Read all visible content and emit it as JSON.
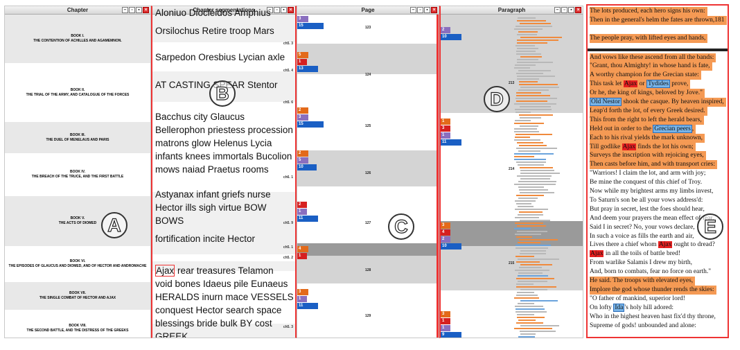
{
  "panels": {
    "chapter": {
      "title": "Chapter"
    },
    "segments": {
      "title": "Chapter segmentations"
    },
    "page": {
      "title": "Page"
    },
    "paragraph": {
      "title": "Paragraph"
    }
  },
  "chapters": [
    {
      "num": "BOOK I.",
      "title": "THE CONTENTION OF ACHILLES AND AGAMEMNON."
    },
    {
      "num": "BOOK II.",
      "title": "THE TRIAL OF THE ARMY, AND CATALOGUE OF THE FORCES"
    },
    {
      "num": "BOOK III.",
      "title": "THE DUEL OF MENELAUS AND PARIS"
    },
    {
      "num": "BOOK IV.",
      "title": "THE BREACH OF THE TRUCE, AND THE FIRST BATTLE"
    },
    {
      "num": "BOOK V.",
      "title": "THE ACTS OF DIOMED"
    },
    {
      "num": "BOOK VI.",
      "title": "THE EPISODES OF GLAUCUS AND DIOMED, AND OF HECTOR AND ANDROMACHE"
    },
    {
      "num": "BOOK VII.",
      "title": "THE SINGLE COMBAT OF HECTOR AND AJAX"
    },
    {
      "num": "BOOK VIII.",
      "title": "THE SECOND BATTLE, AND THE DISTRESS OF THE GREEKS"
    }
  ],
  "segments": [
    {
      "words": "Aloniuo Diocleidos Amphius",
      "label": ""
    },
    {
      "words": "Orsilochus Retire troop Mars",
      "label": "ch5. 3"
    },
    {
      "words": "Sarpedon Oresbius Lycian axle",
      "label": "ch5. 4"
    },
    {
      "words": "AT CASTING SPEAR Stentor",
      "label": "ch5. 6"
    },
    {
      "words": "Bacchus city Glaucus\nBellerophon priestess procession\nmatrons glow Helenus Lycia\ninfants knees immortals Bucolion\nmows naiad Praetus rooms",
      "label": "ch6. 1"
    },
    {
      "words": "Astyanax infant griefs nurse\nHector ills sigh virtue BOW BOWS",
      "label": "ch5. 9"
    },
    {
      "words": "fortification incite Hector",
      "label": "ch5. 1"
    },
    {
      "words": "",
      "label": "ch5. 2"
    },
    {
      "words": "Ajax rear treasures Telamon\nvoid bones Idaeus pile Eunaeus\nHERALDS inurn mace VESSELS\nconquest Hector search space\nblessings bride bulk BY cost GREEK",
      "label": "ch5. 3"
    }
  ],
  "page_marks": [
    {
      "v": "3",
      "c": "#8a6fbf"
    },
    {
      "v": "15",
      "c": "#1a5fc4"
    },
    {
      "v": "5",
      "c": "#e36a1a"
    },
    {
      "v": "1",
      "c": "#d62020"
    },
    {
      "v": "13",
      "c": "#1a5fc4"
    },
    {
      "v": "2",
      "c": "#e36a1a"
    },
    {
      "v": "3",
      "c": "#8a6fbf"
    },
    {
      "v": "15",
      "c": "#1a5fc4"
    },
    {
      "v": "2",
      "c": "#e36a1a"
    },
    {
      "v": "5",
      "c": "#8a6fbf"
    },
    {
      "v": "10",
      "c": "#1a5fc4"
    },
    {
      "v": "2",
      "c": "#d62020"
    },
    {
      "v": "1",
      "c": "#8a6fbf"
    },
    {
      "v": "11",
      "c": "#1a5fc4"
    },
    {
      "v": "4",
      "c": "#e36a1a"
    },
    {
      "v": "1",
      "c": "#d62020"
    },
    {
      "v": "3",
      "c": "#e36a1a"
    },
    {
      "v": "1",
      "c": "#8a6fbf"
    },
    {
      "v": "11",
      "c": "#1a5fc4"
    }
  ],
  "page_numbers": [
    "123",
    "124",
    "125",
    "126",
    "127",
    "128",
    "129"
  ],
  "para_marks": [
    {
      "v": "2",
      "c": "#8a6fbf"
    },
    {
      "v": "10",
      "c": "#1a5fc4"
    },
    {
      "v": "1",
      "c": "#e36a1a"
    },
    {
      "v": "3",
      "c": "#d62020"
    },
    {
      "v": "1",
      "c": "#8a6fbf"
    },
    {
      "v": "11",
      "c": "#1a5fc4"
    },
    {
      "v": "3",
      "c": "#e36a1a"
    },
    {
      "v": "4",
      "c": "#d62020"
    },
    {
      "v": "2",
      "c": "#8a6fbf"
    },
    {
      "v": "10",
      "c": "#1a5fc4"
    },
    {
      "v": "3",
      "c": "#e36a1a"
    },
    {
      "v": "1",
      "c": "#d62020"
    },
    {
      "v": "1",
      "c": "#8a6fbf"
    },
    {
      "v": "9",
      "c": "#1a5fc4"
    }
  ],
  "para_numbers": [
    "213",
    "214",
    "215"
  ],
  "text_lines": [
    {
      "t": "The lots produced, each hero signs his own:",
      "o": true
    },
    {
      "t": "Then in the general's helm the fates are thrown,181",
      "o": true
    },
    {
      "t": "",
      "o": true
    },
    {
      "t": "The people pray, with lifted eyes and hands,",
      "o": true
    },
    {
      "t": "",
      "o": false
    },
    {
      "t": "And vows like these ascend from all the bands:",
      "o": true
    },
    {
      "t": "\"Grant, thou Almighty! in whose hand is fate,",
      "o": true
    },
    {
      "t": "A worthy champion for the Grecian state:",
      "o": true
    },
    {
      "t": "This task let |Ajax| or |Tydides| prove,",
      "o": true
    },
    {
      "t": "Or he, the king of kings, beloved by Jove.\"",
      "o": true
    },
    {
      "t": "|Old Nestor| shook the casque. By heaven inspired,",
      "o": true
    },
    {
      "t": "Leap'd forth the lot, of every Greek desired.",
      "o": true
    },
    {
      "t": "This from the right to left the herald bears,",
      "o": true
    },
    {
      "t": "Held out in order to the |Grecian peers|,",
      "o": true
    },
    {
      "t": "Each to his rival yields the mark unknown,",
      "o": true
    },
    {
      "t": "Till godlike |Ajax| finds the lot his own;",
      "o": true
    },
    {
      "t": "Surveys the inscription with rejoicing eyes,",
      "o": true
    },
    {
      "t": "Then casts before him, and with transport cries:",
      "o": true
    },
    {
      "t": "\"Warriors! I claim the lot, and arm with joy;",
      "o": false
    },
    {
      "t": "Be mine the conquest of this chief of Troy.",
      "o": false
    },
    {
      "t": "Now while my brightest arms my limbs invest,",
      "o": false
    },
    {
      "t": "To Saturn's son be all your vows address'd:",
      "o": false
    },
    {
      "t": "But pray in secret, lest the foes should hear,",
      "o": false
    },
    {
      "t": "And deem your prayers the mean effect of fear.",
      "o": false
    },
    {
      "t": "Said I in secret? No, your vows declare,",
      "o": false
    },
    {
      "t": "In such a voice as fills the earth and air,",
      "o": false
    },
    {
      "t": "Lives there a chief whom |Ajax| ought to dread?",
      "o": false
    },
    {
      "t": "|Ajax| in all the toils of battle bred!",
      "o": false
    },
    {
      "t": "From warlike Salamis I drew my birth,",
      "o": false
    },
    {
      "t": "And, born to combats, fear no force on earth.\"",
      "o": false
    },
    {
      "t": "He said. The troops with elevated eyes,",
      "o": true
    },
    {
      "t": "Implore the god whose thunder rends the skies:",
      "o": true
    },
    {
      "t": "\"O father of mankind, superior lord!",
      "o": false
    },
    {
      "t": "On lofty |Ida|'s holy hill adored:",
      "o": false
    },
    {
      "t": "Who in the highest heaven hast fix'd thy throne,",
      "o": false
    },
    {
      "t": "Supreme of gods! unbounded and alone:",
      "o": false
    }
  ],
  "highlight_colors": {
    "Ajax": "r",
    "Tydides": "b",
    "Old Nestor": "b",
    "Grecian peers": "b",
    "Ida": "b"
  },
  "annotations": [
    "A",
    "B",
    "C",
    "D",
    "E"
  ]
}
